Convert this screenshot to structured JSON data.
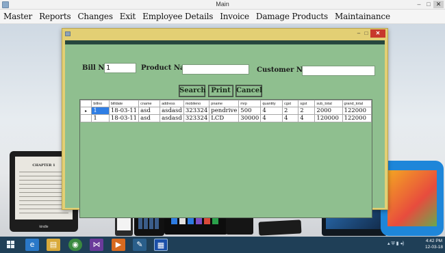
{
  "window": {
    "title": "Main",
    "controls": {
      "minimize": "‒",
      "maximize": "□",
      "close": "✕"
    }
  },
  "menu": [
    "Master",
    "Reports",
    "Changes",
    "Exit",
    "Employee Details",
    "Invoice",
    "Damage Products",
    "Maintainance"
  ],
  "form": {
    "controls": {
      "minimize": "‒",
      "maximize": "□",
      "close": "✕"
    },
    "bill_no_label": "Bill No :",
    "bill_no_value": "1",
    "product_name_label": "Product Name :",
    "product_name_value": "",
    "customer_name_label": "Customer Name :",
    "customer_name_value": "",
    "buttons": {
      "search": "Search",
      "print": "Print",
      "cancel": "Cancel"
    },
    "grid": {
      "columns": [
        "billno",
        "billdate",
        "cname",
        "address",
        "mobileno",
        "pname",
        "mrp",
        "quantity",
        "cgst",
        "sgst",
        "sub_total",
        "grand_total"
      ],
      "rows": [
        [
          "1",
          "18-03-11",
          "asd",
          "asdasd",
          "323324",
          "pendrive",
          "500",
          "4",
          "2",
          "2",
          "2000",
          "122000"
        ],
        [
          "1",
          "18-03-11",
          "asd",
          "asdasd",
          "323324",
          "LCD",
          "30000",
          "4",
          "4",
          "4",
          "120000",
          "122000"
        ]
      ],
      "current_row_marker": "▸"
    }
  },
  "desktop": {
    "kindle_chapter": "CHAPTER 1",
    "kindle_brand": "kindle"
  },
  "taskbar": {
    "clock_time": "4:42 PM",
    "clock_date": "12-03-18",
    "colors": {
      "taskbar": "#1f3f57",
      "form_bg": "#8fbf8f",
      "form_frame": "#e3cf74",
      "selection": "#2f7ee4"
    }
  }
}
